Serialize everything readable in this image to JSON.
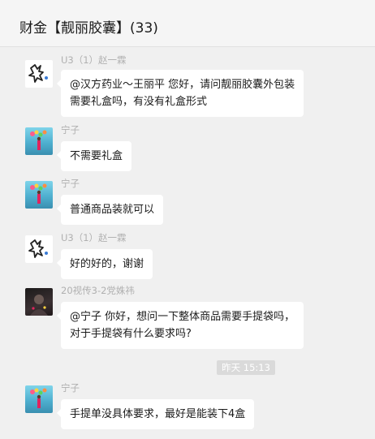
{
  "chat": {
    "title": "财金【靓丽胶囊】(33)"
  },
  "messages": [
    {
      "sender": "U3（1）赵一霖",
      "avatar": "doodle-logo-avatar",
      "lines": [
        "@汉方药业～王丽平 您好，请问靓丽胶囊外包装",
        "需要礼盒吗，有没有礼盒形式"
      ]
    },
    {
      "sender": "宁子",
      "avatar": "photo-avatar",
      "lines": [
        "不需要礼盒"
      ]
    },
    {
      "sender": "宁子",
      "avatar": "photo-avatar",
      "lines": [
        "普通商品装就可以"
      ]
    },
    {
      "sender": "U3（1）赵一霖",
      "avatar": "doodle-logo-avatar",
      "lines": [
        "好的好的，谢谢"
      ]
    },
    {
      "sender": "20视传3-2党姝祎",
      "avatar": "dark-photo-avatar",
      "lines": [
        "@宁子  你好，想问一下整体商品需要手提袋吗，",
        "对于手提袋有什么要求吗?"
      ]
    },
    {
      "sender": "宁子",
      "avatar": "photo-avatar",
      "lines": [
        "手提单没具体要求，最好是能装下4盒"
      ]
    }
  ],
  "timestamp": "昨天 15:13"
}
